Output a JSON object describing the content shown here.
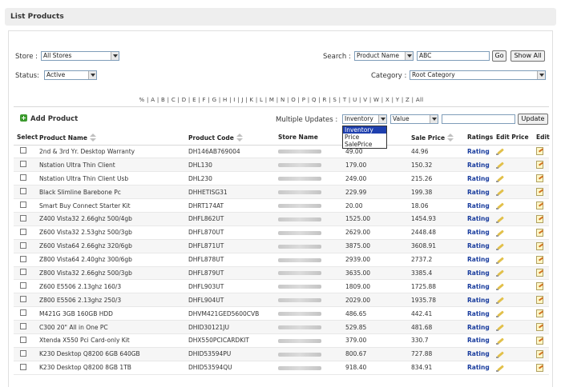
{
  "page": {
    "title": "List Products"
  },
  "filters": {
    "store_label": "Store :",
    "store_value": "All Stores",
    "status_label": "Status:",
    "status_value": "Active",
    "search_label": "Search :",
    "search_field_value": "Product Name",
    "search_text": "ABC",
    "go_label": "Go",
    "show_all_label": "Show All",
    "category_label": "Category :",
    "category_value": "Root Category"
  },
  "alpha_filter": "% | A | B | C | D | E | F | G | H | I | J | K | L | M | N | O | P | Q | R | S | T | U | V | W | X | Y | Z | All",
  "toolbar": {
    "add_product_label": "Add Product",
    "multiple_updates_label": "Multiple Updates :",
    "update_type_value": "Inventory",
    "update_type_options": [
      "Inventory",
      "Price",
      "SalePrice"
    ],
    "value_select": "Value",
    "update_label": "Update"
  },
  "table": {
    "headers": [
      "Select",
      "Product Name",
      "Product Code",
      "Store Name",
      "Price",
      "Sale Price",
      "Ratings",
      "Edit Price",
      "Edit"
    ],
    "rating_link": "Rating",
    "rows": [
      {
        "name": "2nd & 3rd Yr. Desktop Warranty",
        "code": "DH146AB769004",
        "price": "49.00",
        "sale": "44.96"
      },
      {
        "name": "Nstation Ultra Thin Client",
        "code": "DHL130",
        "price": "179.00",
        "sale": "150.32"
      },
      {
        "name": "Nstation Ultra Thin Client Usb",
        "code": "DHL230",
        "price": "249.00",
        "sale": "215.26"
      },
      {
        "name": "Black Slimline Barebone Pc",
        "code": "DHHETISG31",
        "price": "229.99",
        "sale": "199.38"
      },
      {
        "name": "Smart Buy Connect Starter Kit",
        "code": "DHRT174AT",
        "price": "20.00",
        "sale": "18.06"
      },
      {
        "name": "Z400 Vista32 2.66ghz 500/4gb",
        "code": "DHFL862UT",
        "price": "1525.00",
        "sale": "1454.93"
      },
      {
        "name": "Z600 Vista32 2.53ghz 500/3gb",
        "code": "DHFL870UT",
        "price": "2629.00",
        "sale": "2448.48"
      },
      {
        "name": "Z600 Vista64 2.66ghz 320/6gb",
        "code": "DHFL871UT",
        "price": "3875.00",
        "sale": "3608.91"
      },
      {
        "name": "Z800 Vista64 2.40ghz 300/6gb",
        "code": "DHFL878UT",
        "price": "2939.00",
        "sale": "2737.2"
      },
      {
        "name": "Z800 Vista32 2.66ghz 500/3gb",
        "code": "DHFL879UT",
        "price": "3635.00",
        "sale": "3385.4"
      },
      {
        "name": "Z600 E5506 2.13ghz 160/3",
        "code": "DHFL903UT",
        "price": "1809.00",
        "sale": "1725.88"
      },
      {
        "name": "Z800 E5506 2.13ghz 250/3",
        "code": "DHFL904UT",
        "price": "2029.00",
        "sale": "1935.78"
      },
      {
        "name": "M421G 3GB 160GB HDD",
        "code": "DHVM421GED5600CVB",
        "price": "486.65",
        "sale": "442.41"
      },
      {
        "name": "C300 20\" All in One PC",
        "code": "DHID30121JU",
        "price": "529.85",
        "sale": "481.68"
      },
      {
        "name": "Xtenda X550 Pci Card-only Kit",
        "code": "DHX550PCICARDKIT",
        "price": "379.00",
        "sale": "330.7"
      },
      {
        "name": "K230 Desktop Q8200 6GB 640GB",
        "code": "DHID53594PU",
        "price": "800.67",
        "sale": "727.88"
      },
      {
        "name": "K230 Desktop Q8200 8GB 1TB",
        "code": "DHID53594QU",
        "price": "918.40",
        "sale": "834.91"
      }
    ]
  }
}
